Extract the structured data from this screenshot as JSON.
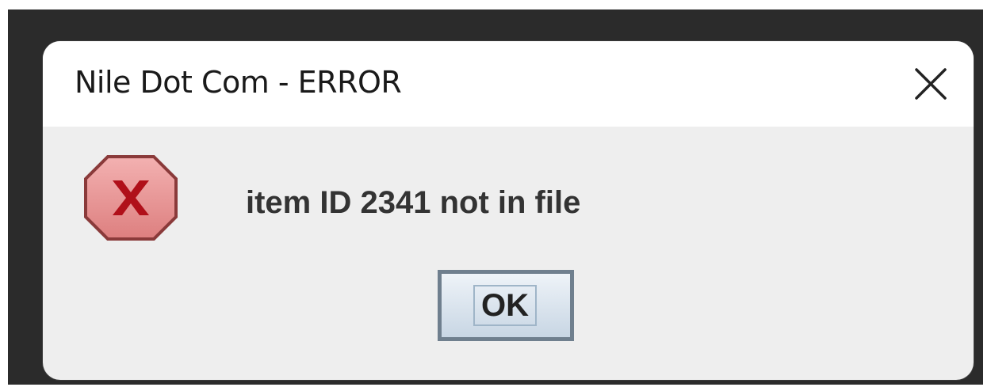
{
  "dialog": {
    "title": "Nile Dot Com - ERROR",
    "message": "item ID 2341 not in file",
    "ok_label": "OK"
  },
  "icons": {
    "close": "close-icon",
    "error": "error-icon"
  },
  "colors": {
    "error_fill": "#e89393",
    "error_x": "#b0101a",
    "ok_border": "#6f7f8e"
  }
}
